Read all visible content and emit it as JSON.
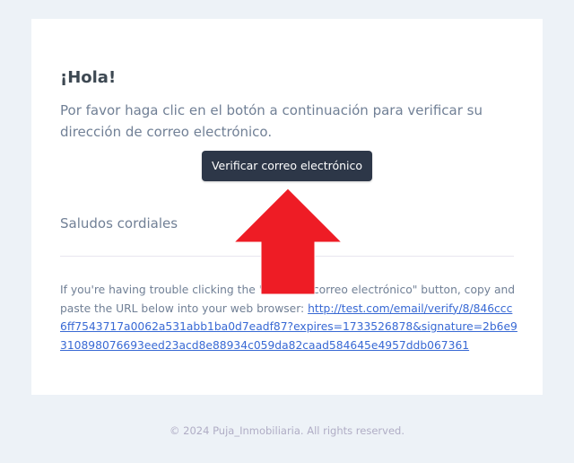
{
  "email": {
    "greeting": "¡Hola!",
    "intro_line": "Por favor haga clic en el botón a continuación para verificar su dirección de correo electrónico.",
    "verify_button_label": "Verificar correo electrónico",
    "regards": "Saludos cordiales",
    "subcopy": {
      "text_before_link": "If you're having trouble clicking the \"Verificar correo electrónico\" button, copy and paste the URL below into your web browser: ",
      "link_text": "http://test.com/email/verify/8/846ccc6ff7543717a0062a531abb1ba0d7eadf87?expires=1733526878&signature=2b6e9310898076693eed23acd8e88934c059da82caad584645e4957ddb067361"
    }
  },
  "footer": {
    "copyright": "© 2024 Puja_Inmobiliaria. All rights reserved."
  },
  "annotation": {
    "arrow_icon": "up-arrow-icon",
    "arrow_color": "#ee1c25"
  },
  "colors": {
    "page_background": "#edf2f7",
    "card_background": "#ffffff",
    "button_background": "#2d3748",
    "link": "#3869d4",
    "body_text": "#718096",
    "heading_text": "#3d4852"
  }
}
